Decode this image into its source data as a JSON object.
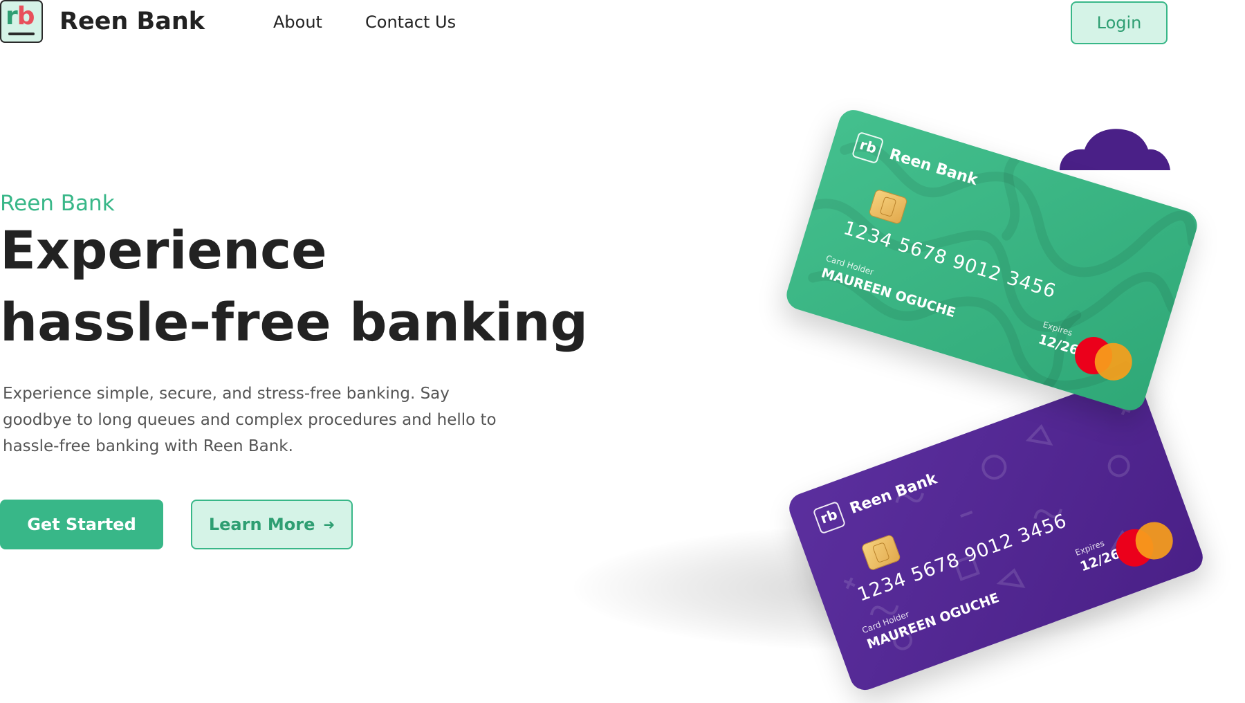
{
  "header": {
    "logo_text": "rb",
    "brand_name": "Reen Bank",
    "nav": {
      "about": "About",
      "contact": "Contact Us"
    },
    "login_label": "Login"
  },
  "hero": {
    "eyebrow": "Reen Bank",
    "headline_line1": "Experience",
    "headline_line2": "hassle-free banking",
    "description": "Experience simple, secure, and stress-free banking. Say goodbye to long queues and complex procedures and hello to hassle-free banking with Reen Bank.",
    "primary_button": "Get Started",
    "secondary_button": "Learn More",
    "secondary_button_icon": "arrow-right-icon"
  },
  "cards": {
    "green": {
      "logo": "rb",
      "brand": "Reen Bank",
      "number": "1234 5678 9012 3456",
      "holder_label": "Card Holder",
      "holder_name": "MAUREEN OGUCHE",
      "expires_label": "Expires",
      "expires_value": "12/26"
    },
    "purple": {
      "logo": "rb",
      "brand": "Reen Bank",
      "number": "1234 5678 9012 3456",
      "holder_label": "Card Holder",
      "holder_name": "MAUREEN OGUCHE",
      "expires_label": "Expires",
      "expires_value": "12/26"
    }
  },
  "colors": {
    "accent": "#38b788",
    "accent_light": "#d5f3e7",
    "card_green": "#3cb884",
    "card_purple": "#4f2490",
    "cloud": "#4a2087",
    "text_dark": "#222222",
    "text_muted": "#555555"
  }
}
